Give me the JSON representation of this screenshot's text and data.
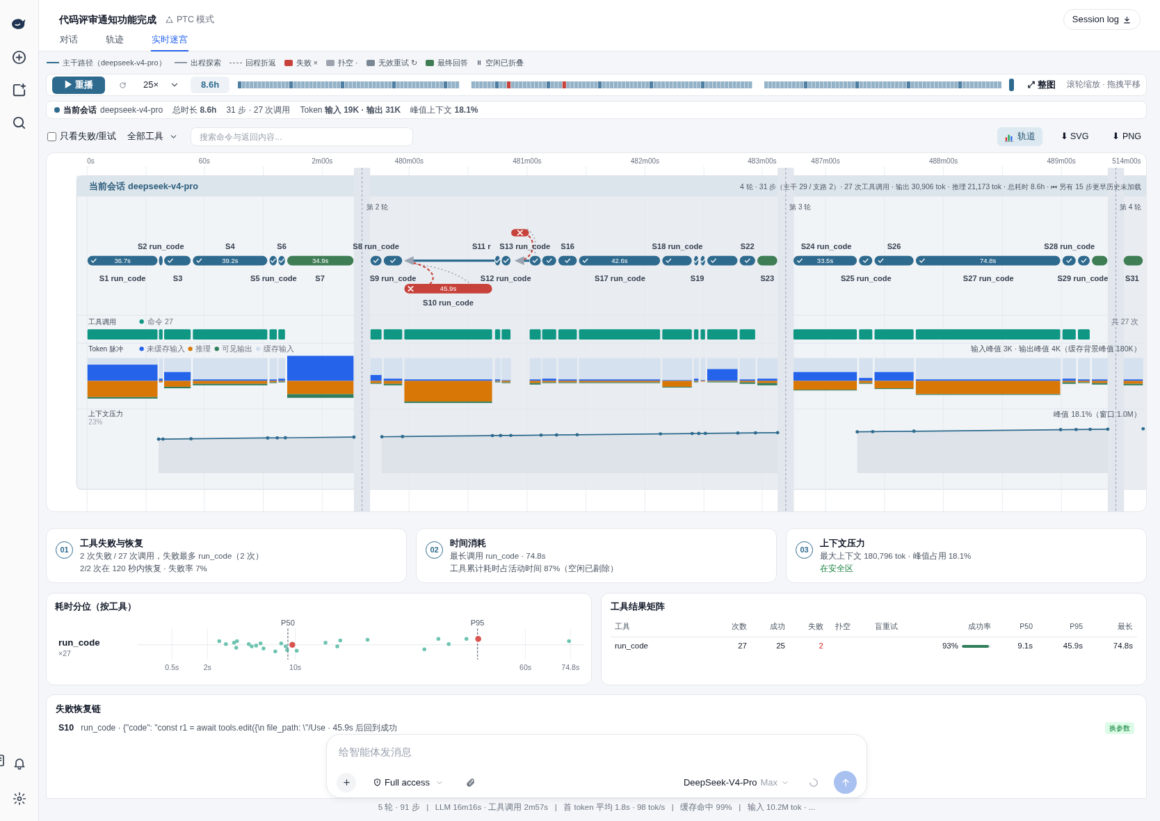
{
  "header": {
    "title": "代码评审通知功能完成",
    "mode": "PTC 模式",
    "session_log": "Session log"
  },
  "tabs": [
    {
      "label": "对话",
      "selected": false
    },
    {
      "label": "轨迹",
      "selected": false
    },
    {
      "label": "实时迷宫",
      "selected": true
    }
  ],
  "legend": [
    {
      "label": "主干路径（deepseek-v4-pro）",
      "kind": "line"
    },
    {
      "label": "出程探索",
      "kind": "thin"
    },
    {
      "label": "回程折返",
      "kind": "dashed"
    },
    {
      "label": "失败 ×",
      "kind": "swatch",
      "color": "#c7423b"
    },
    {
      "label": "扑空 ·",
      "kind": "swatch",
      "color": "#9ca3af"
    },
    {
      "label": "无效重试 ↻",
      "kind": "swatch",
      "color": "#7b8794"
    },
    {
      "label": "最终回答",
      "kind": "swatch",
      "color": "#3f7d55"
    },
    {
      "label": "空闲已折叠",
      "kind": "pause"
    }
  ],
  "player": {
    "button": "▶ 重播",
    "speed": "25×",
    "duration": "8.6h",
    "level": 1,
    "fit": "⤢ 整图",
    "hint": "滚轮缩放 · 拖拽平移"
  },
  "session": {
    "label": "当前会话",
    "model": "deepseek-v4-pro",
    "stats": [
      "总时长 **8.6h**",
      "31 步 · 27 次调用",
      "Token **输入 19K · 输出 31K**",
      "峰值上下文 **18.1%**"
    ]
  },
  "filter": {
    "checkbox": {
      "label": "只看失败/重试",
      "checked": false
    },
    "tool_select": "全部工具",
    "search": {
      "placeholder": "搜索命令与返回内容..."
    },
    "track_toggle": {
      "label": "轨道",
      "selected": true
    },
    "exports": [
      "⬇ SVG",
      "⬇ PNG"
    ]
  },
  "maze": {
    "axis": [
      "0s",
      "60s",
      "2m00s",
      "480m00s",
      "481m00s",
      "482m00s",
      "483m00s",
      "487m00s",
      "488m00s",
      "489m00s",
      "514m00s"
    ],
    "band_title": "当前会话 deepseek-v4-pro",
    "band_summary": "4 轮 · 31 步（主干 29 / 支路 2）· 27 次工具调用 · 输出 30,906 tok · 推理 21,173 tok · 总耗时 8.6h · ⏮ 另有 15 步更早历史未加载",
    "rounds": [
      "第 2 轮",
      "第 3 轮",
      "第 4 轮"
    ],
    "steps": [
      {
        "label": "S1 run_code",
        "duration": "36.7s",
        "failed": false,
        "final": false
      },
      {
        "label": "S2 run_code",
        "failed": false,
        "final": false
      },
      {
        "label": "S3",
        "failed": false,
        "final": false
      },
      {
        "label": "S4",
        "duration": "39.2s",
        "failed": false,
        "final": false
      },
      {
        "label": "S5 run_code",
        "failed": false,
        "final": false
      },
      {
        "label": "S6",
        "failed": false,
        "final": false
      },
      {
        "label": "S7",
        "duration": "34.9s",
        "failed": false,
        "final": true
      },
      {
        "label": "S8 run_code",
        "failed": false,
        "final": false
      },
      {
        "label": "S9 run_code",
        "failed": false,
        "final": false
      },
      {
        "label": "S10 run_code",
        "duration": "45.9s",
        "failed": true,
        "final": false
      },
      {
        "label": "S11 r",
        "failed": false,
        "final": false
      },
      {
        "label": "S12 run_code",
        "failed": false,
        "final": false
      },
      {
        "label": "S13 run_code",
        "failed": true,
        "final": false
      },
      {
        "failed": false,
        "final": false
      },
      {
        "failed": false,
        "final": false
      },
      {
        "label": "S16",
        "failed": false,
        "final": false
      },
      {
        "label": "S17 run_code",
        "duration": "42.6s",
        "failed": false,
        "final": false
      },
      {
        "label": "S18 run_code",
        "failed": false,
        "final": false
      },
      {
        "label": "S19",
        "failed": false,
        "final": false
      },
      {
        "failed": false,
        "final": false
      },
      {
        "failed": false,
        "final": false
      },
      {
        "label": "S22",
        "failed": false,
        "final": false
      },
      {
        "label": "S23",
        "failed": false,
        "final": true
      },
      {
        "label": "S24 run_code",
        "duration": "33.5s",
        "failed": false,
        "final": false
      },
      {
        "label": "S25 run_code",
        "failed": false,
        "final": false
      },
      {
        "label": "S26",
        "failed": false,
        "final": false
      },
      {
        "label": "S27 run_code",
        "duration": "74.8s",
        "failed": false,
        "final": false
      },
      {
        "label": "S28 run_code",
        "failed": false,
        "final": false
      },
      {
        "label": "S29 run_code",
        "failed": false,
        "final": false
      },
      {
        "failed": false,
        "final": true
      },
      {
        "label": "S31",
        "failed": false,
        "final": true
      }
    ],
    "tool_row": {
      "title": "工具调用",
      "legend": "命令 27",
      "total": "共 27 次"
    },
    "token_row": {
      "title": "Token 脉冲",
      "legend": [
        {
          "label": "未缓存输入",
          "color": "#2563eb"
        },
        {
          "label": "推理",
          "color": "#d97706"
        },
        {
          "label": "可见输出",
          "color": "#2f7d5b"
        },
        {
          "label": "缓存输入",
          "color": "#d3dff0"
        }
      ],
      "peak": "输入峰值 3K · 输出峰值 4K（缓存背景峰值 180K）"
    },
    "context_row": {
      "title": "上下文压力",
      "max": "23%",
      "peak": "峰值 18.1%（窗口 1.0M）"
    }
  },
  "insights": [
    {
      "number": "01",
      "title": "工具失败与恢复",
      "lines": [
        {
          "text": "2 次失败 / 27 次调用，失败最多 run_code（2 次）",
          "safe": false
        },
        {
          "text": "2/2 次在 120 秒内恢复 · 失败率 7%",
          "safe": false
        }
      ]
    },
    {
      "number": "02",
      "title": "时间消耗",
      "lines": [
        {
          "text": "最长调用 run_code · 74.8s",
          "safe": false
        },
        {
          "text": "工具累计耗时占活动时间 87%（空闲已剔除）",
          "safe": false
        }
      ]
    },
    {
      "number": "03",
      "title": "上下文压力",
      "lines": [
        {
          "text": "最大上下文 180,796 tok · 峰值占用 18.1%",
          "safe": false
        },
        {
          "text": "在安全区",
          "safe": true
        }
      ]
    }
  ],
  "percentiles": {
    "title": "耗时分位（按工具）",
    "tool": "run_code",
    "count": "×27",
    "markers": [
      "P50",
      "P95"
    ],
    "ticks": [
      "0.5s",
      "2s",
      "10s",
      "60s",
      "74.8s"
    ]
  },
  "matrix": {
    "title": "工具结果矩阵",
    "columns": [
      "工具",
      "次数",
      "成功",
      "失败",
      "扑空",
      "盲重试",
      "成功率",
      "P50",
      "P95",
      "最长"
    ],
    "rows": [
      {
        "tool": "run_code",
        "count": "27",
        "success": "25",
        "failed": "2",
        "rate": "93%",
        "level": 0.93,
        "p50": "9.1s",
        "p95": "45.9s",
        "max": "74.8s"
      }
    ]
  },
  "failure_chain": {
    "title": "失败恢复链",
    "items": [
      {
        "step": "S10",
        "text": "run_code · {\"code\": \"const r1 = await tools.edit({\\n file_path: \\\"/Use · 45.9s 后回到成功",
        "tag": "换参数"
      }
    ]
  },
  "composer": {
    "placeholder": "给智能体发消息",
    "access": "Full access",
    "model": "DeepSeek-V4-Pro",
    "effort": "Max"
  },
  "footer": "5 轮 · 91 步   |   LLM 16m16s · 工具调用 2m57s   |   首 token 平均 1.8s · 98 tok/s   |   缓存命中 99%   |   输入 10.2M tok · ..."
}
